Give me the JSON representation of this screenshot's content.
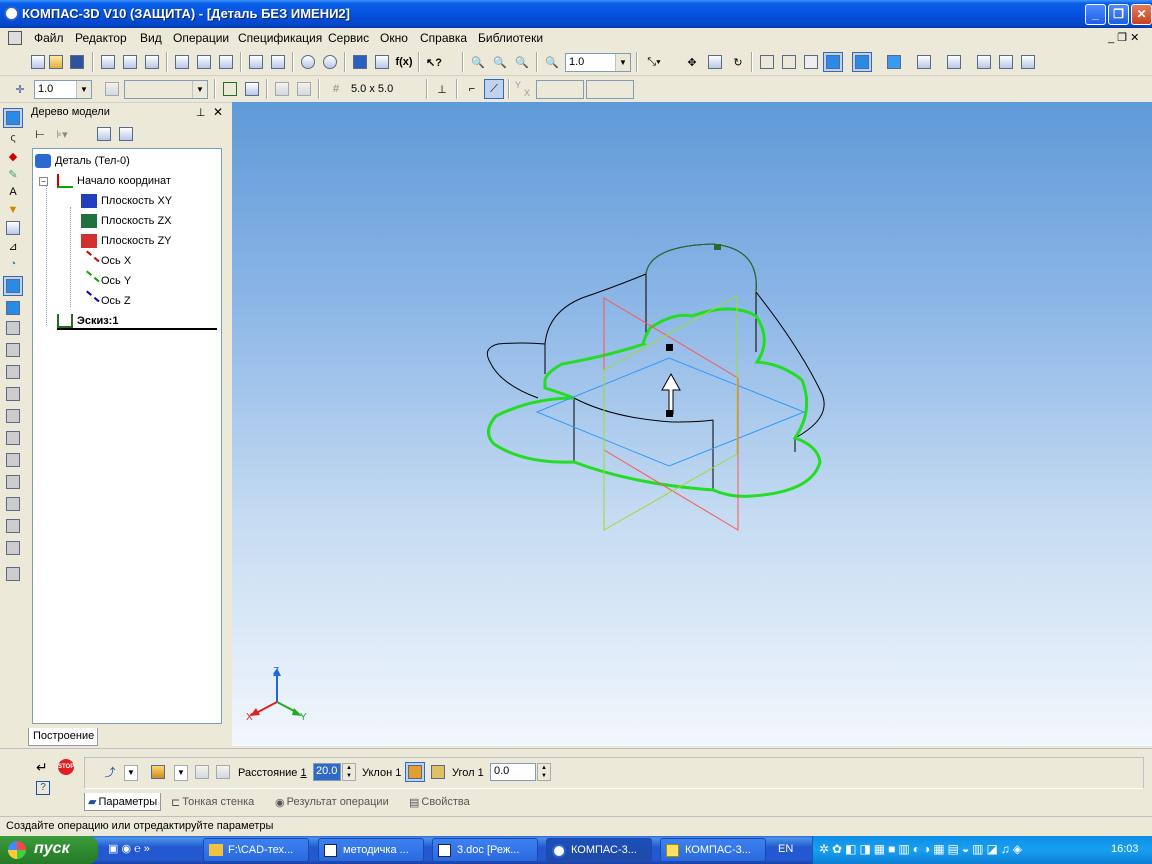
{
  "window": {
    "title": "КОМПАС-3D V10 (ЗАЩИТА) - [Деталь БЕЗ ИМЕНИ2]"
  },
  "menu": [
    "Файл",
    "Редактор",
    "Вид",
    "Операции",
    "Спецификация",
    "Сервис",
    "Окно",
    "Справка",
    "Библиотеки"
  ],
  "toolbar1": {
    "zoom_value": "1.0"
  },
  "toolbar2": {
    "step_value": "1.0",
    "grid_label": "5.0 x 5.0",
    "y_axis_label": "Y",
    "x_axis_label": "X"
  },
  "tree": {
    "title": "Дерево модели",
    "items": [
      {
        "label": "Деталь (Тел-0)"
      },
      {
        "label": "Начало координат"
      },
      {
        "label": "Плоскость XY"
      },
      {
        "label": "Плоскость ZX"
      },
      {
        "label": "Плоскость ZY"
      },
      {
        "label": "Ось X"
      },
      {
        "label": "Ось Y"
      },
      {
        "label": "Ось Z"
      },
      {
        "label": "Эскиз:1"
      }
    ],
    "tab": "Построение"
  },
  "viewport": {
    "axis_z": "Z",
    "axis_x": "X",
    "axis_y": "Y"
  },
  "props": {
    "distance_label": "Расстояние",
    "distance_index": "1",
    "distance_value": "20.0",
    "slope_label": "Уклон",
    "slope_index": "1",
    "angle_label": "Угол",
    "angle_index": "1",
    "angle_value": "0.0",
    "tabs": [
      "Параметры",
      "Тонкая стенка",
      "Результат операции",
      "Свойства"
    ]
  },
  "status": "Создайте операцию или отредактируйте параметры",
  "taskbar": {
    "start": "пуск",
    "buttons": [
      "F:\\CAD-тех...",
      "методичка ...",
      "3.doc [Реж...",
      "КОМПАС-3...",
      "КОМПАС-3..."
    ],
    "lang": "EN",
    "clock": "16:03"
  },
  "colors": {
    "sketch_green": "#22dd22",
    "plane_xy": "#3399ff",
    "plane_zx": "#ff5555",
    "plane_zy": "#99dd33",
    "titlebar": "#0553e0"
  }
}
